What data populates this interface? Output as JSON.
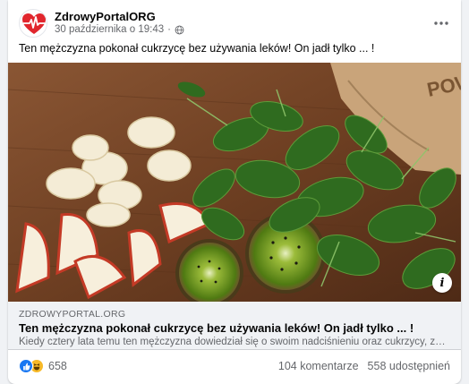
{
  "post": {
    "page_name": "ZdrowyPortalORG",
    "date": "30 października o 19:43",
    "separator": "·",
    "text": "Ten mężczyzna pokonał cukrzycę bez używania leków! On jadł tylko ... !"
  },
  "link": {
    "domain": "ZDROWYPORTAL.ORG",
    "title": "Ten mężczyzna pokonał cukrzycę bez używania leków! On jadł tylko ... !",
    "description": "Kiedy cztery lata temu ten mężczyzna dowiedział się o swoim nadciśnieniu oraz cukrzycy, zaczął szukać naturalnych sposobów leczenia"
  },
  "image": {
    "bag_text": "POW"
  },
  "stats": {
    "reactions_count": "658",
    "comments": "104 komentarze",
    "shares": "558 udostępnień"
  },
  "colors": {
    "accent": "#1877f2",
    "haha": "#f7b928",
    "logo_red": "#e1262d",
    "secondary_text": "#65676b"
  }
}
